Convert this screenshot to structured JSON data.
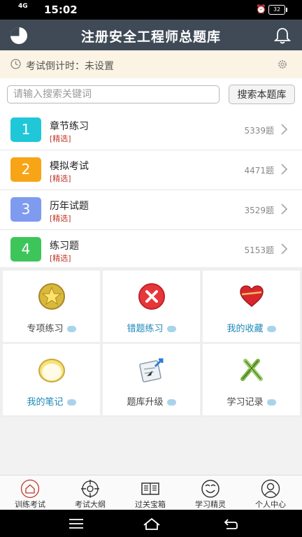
{
  "status_bar": {
    "signal": "4G",
    "time": "15:02",
    "battery": "32"
  },
  "header": {
    "title": "注册安全工程师总题库"
  },
  "countdown": {
    "label": "考试倒计时：未设置"
  },
  "search": {
    "placeholder": "请输入搜索关键词",
    "button_label": "搜索本题库"
  },
  "categories": [
    {
      "num": "1",
      "name": "章节练习",
      "tag": "[精选]",
      "count": "5339题",
      "color": "#1fc7d9"
    },
    {
      "num": "2",
      "name": "模拟考试",
      "tag": "[精选]",
      "count": "4471题",
      "color": "#f7a516"
    },
    {
      "num": "3",
      "name": "历年试题",
      "tag": "[精选]",
      "count": "3529题",
      "color": "#7f9bef"
    },
    {
      "num": "4",
      "name": "练习题",
      "tag": "[精选]",
      "count": "5153题",
      "color": "#3ec55a"
    }
  ],
  "tiles": [
    {
      "label": "专项练习",
      "icon": "star-badge-icon"
    },
    {
      "label": "错题练习",
      "icon": "red-x-icon"
    },
    {
      "label": "我的收藏",
      "icon": "heart-icon"
    },
    {
      "label": "我的笔记",
      "icon": "notepad-icon"
    },
    {
      "label": "题库升级",
      "icon": "upgrade-icon"
    },
    {
      "label": "学习记录",
      "icon": "pencils-icon"
    }
  ],
  "tabbar": [
    {
      "label": "训练考试",
      "icon": "home-icon"
    },
    {
      "label": "考试大纲",
      "icon": "crosshair-icon"
    },
    {
      "label": "过关宝箱",
      "icon": "book-icon"
    },
    {
      "label": "学习精灵",
      "icon": "smiley-icon"
    },
    {
      "label": "个人中心",
      "icon": "person-icon"
    }
  ]
}
